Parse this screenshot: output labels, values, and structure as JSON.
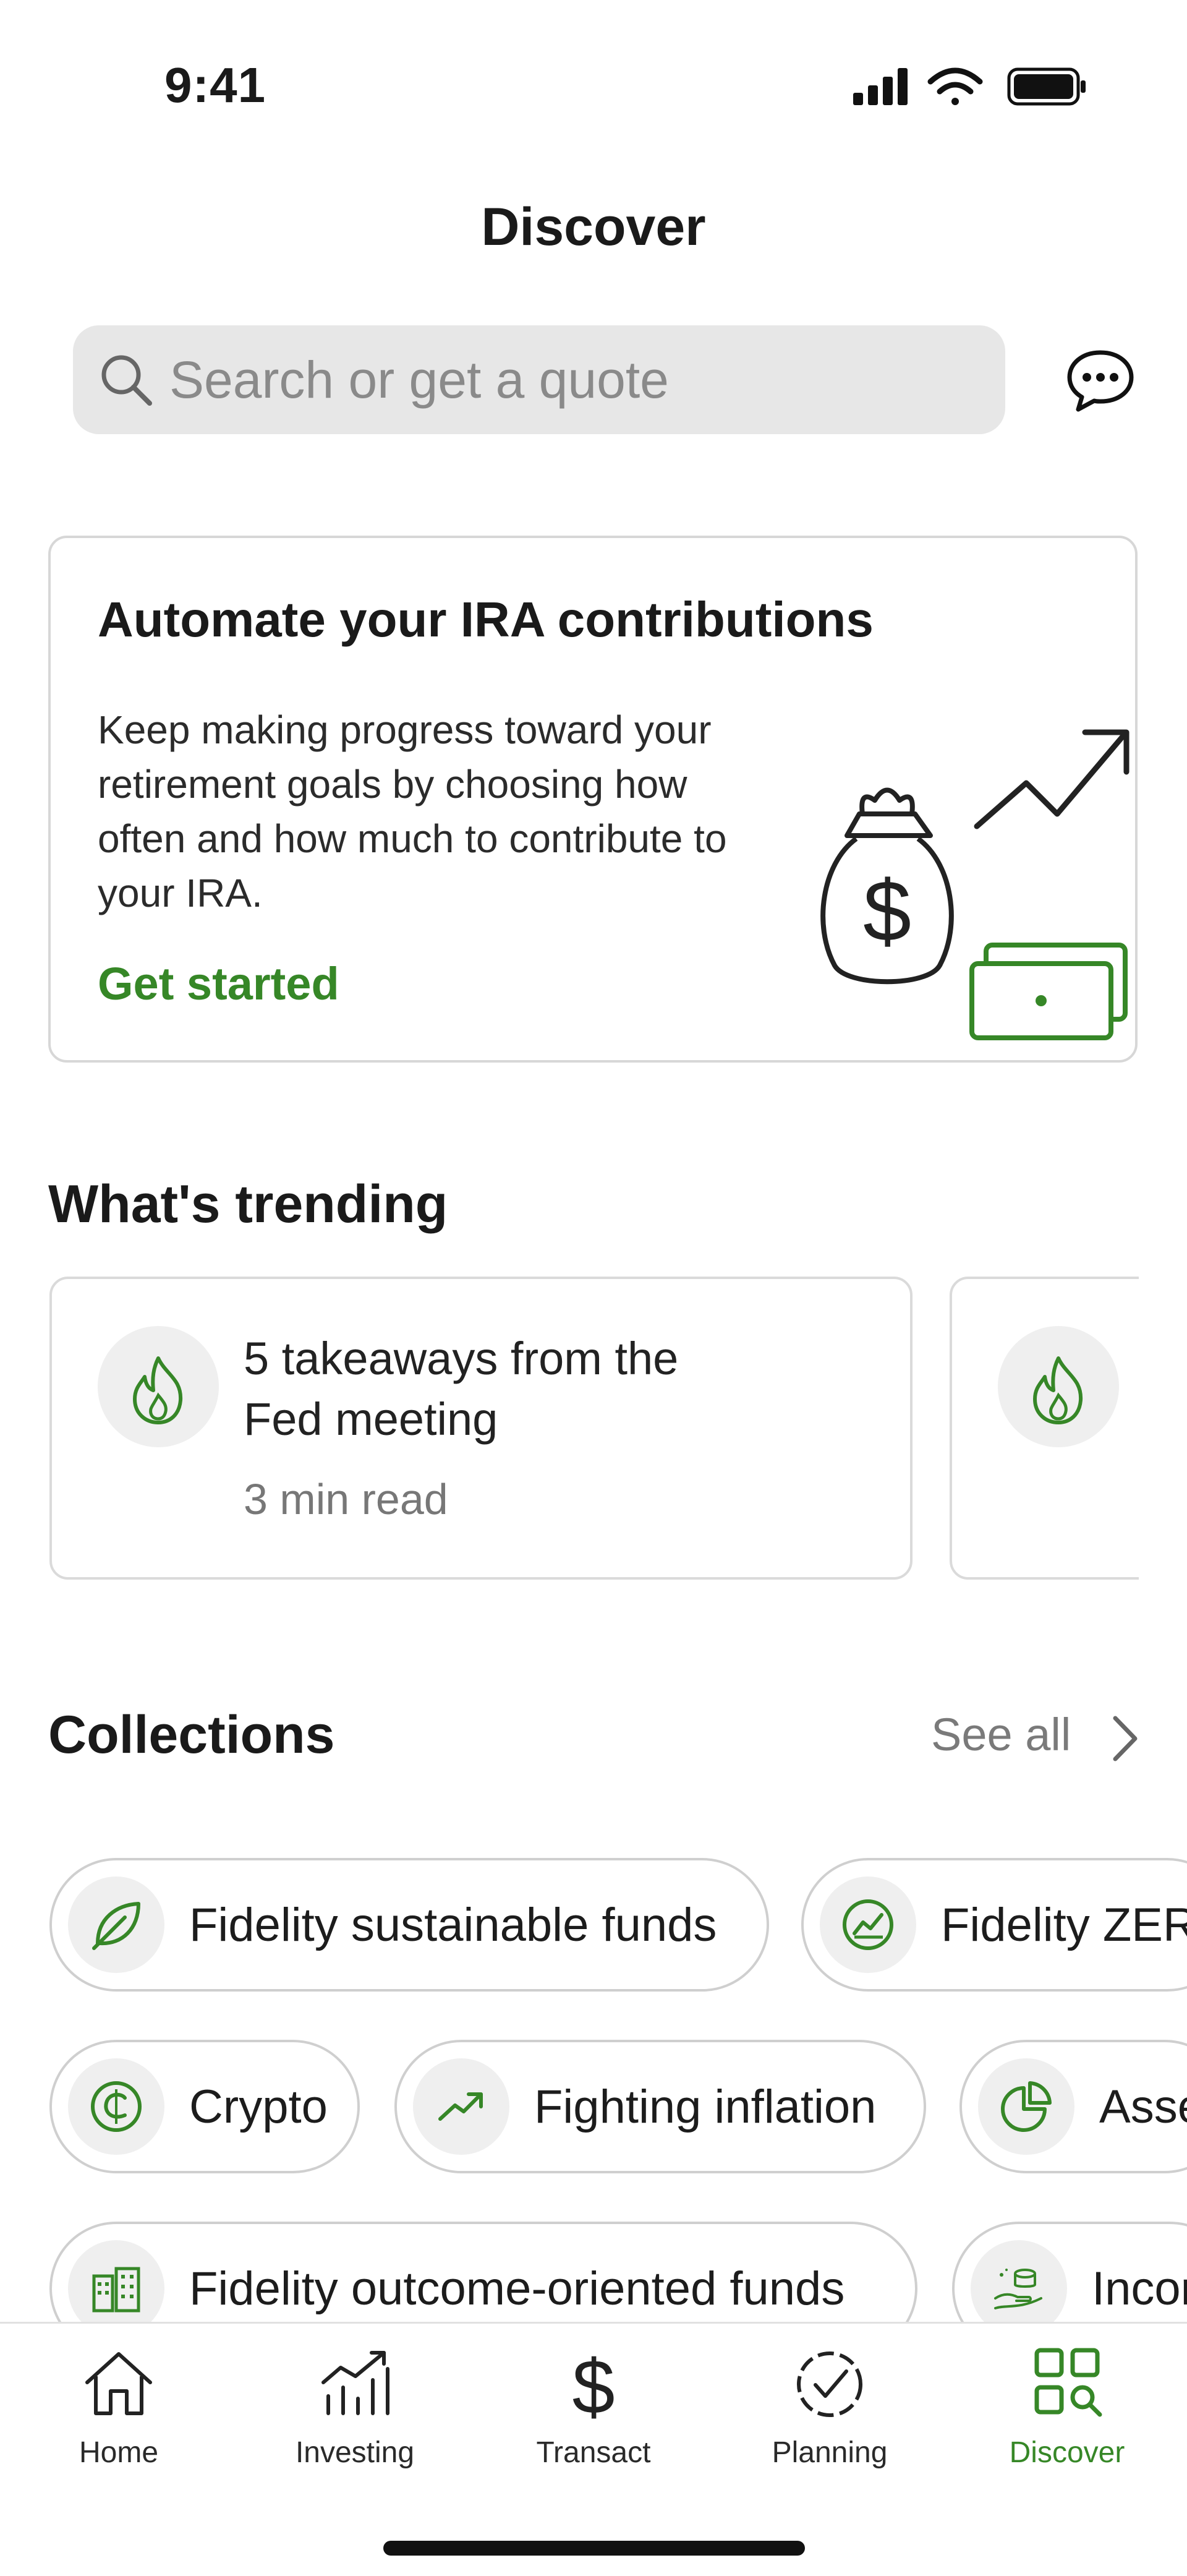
{
  "status": {
    "time": "9:41"
  },
  "header": {
    "title": "Discover"
  },
  "search": {
    "placeholder": "Search or get a quote"
  },
  "promo": {
    "title": "Automate your IRA contributions",
    "body": "Keep making progress toward your retirement goals by choosing how often and how much to contribute to your IRA.",
    "cta": "Get started"
  },
  "trending": {
    "title": "What's trending",
    "cards": [
      {
        "headline": "5 takeaways from the Fed meeting",
        "meta": "3 min read"
      }
    ]
  },
  "collections": {
    "title": "Collections",
    "see_all": "See all",
    "chips": [
      {
        "label": "Fidelity sustainable funds",
        "icon": "leaf-icon"
      },
      {
        "label": "Fidelity ZERO",
        "icon": "chart-icon"
      },
      {
        "label": "Crypto",
        "icon": "crypto-coin-icon"
      },
      {
        "label": "Fighting inflation",
        "icon": "trending-up-icon"
      },
      {
        "label": "Asset",
        "icon": "pie-chart-icon"
      },
      {
        "label": "Fidelity outcome-oriented funds",
        "icon": "buildings-icon"
      },
      {
        "label": "Income",
        "icon": "hand-coins-icon"
      }
    ]
  },
  "nav": {
    "items": [
      {
        "label": "Home",
        "icon": "home-icon"
      },
      {
        "label": "Investing",
        "icon": "investing-icon"
      },
      {
        "label": "Transact",
        "icon": "dollar-icon"
      },
      {
        "label": "Planning",
        "icon": "planning-icon"
      },
      {
        "label": "Discover",
        "icon": "discover-icon"
      }
    ],
    "active": "Discover"
  },
  "colors": {
    "accent": "#368727",
    "text": "#1a1a1a",
    "muted": "#777777",
    "border": "#d7d7d7"
  }
}
